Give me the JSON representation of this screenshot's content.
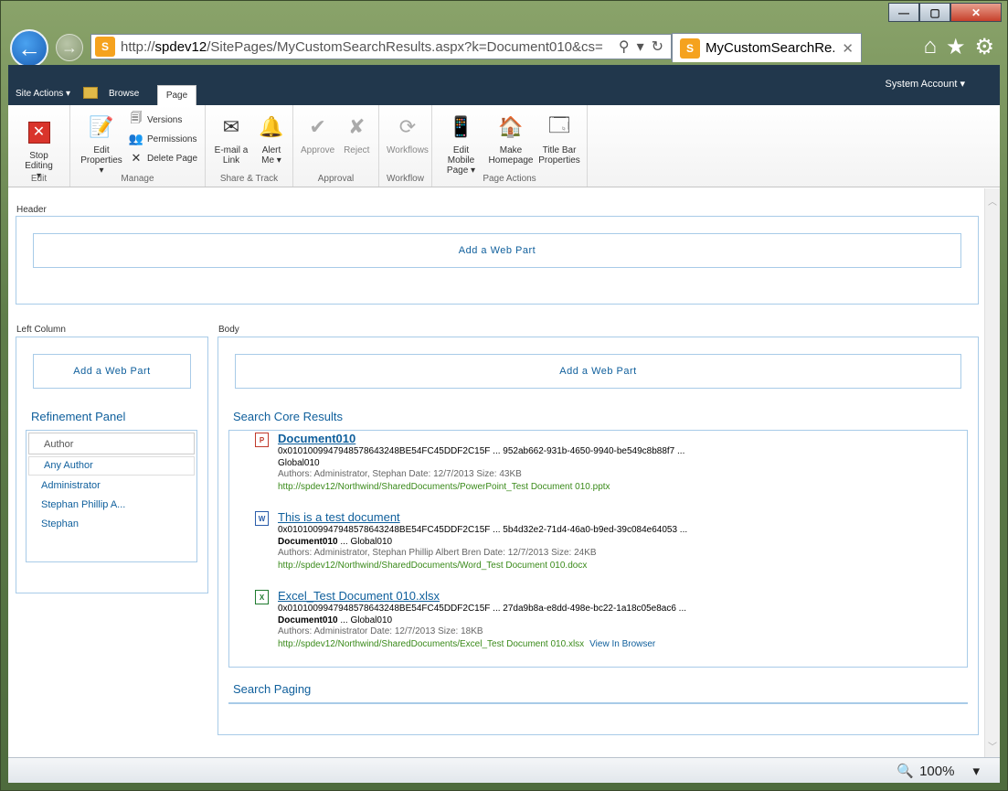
{
  "browser": {
    "url_prefix": "http://",
    "url_host": "spdev12",
    "url_rest": "/SitePages/MyCustomSearchResults.aspx?k=Document010&cs=",
    "tab_title": "MyCustomSearchRe...",
    "tab_close": "✕",
    "win_min": "—",
    "win_max": "▢",
    "win_close": "✕",
    "zoom": "100%"
  },
  "ribbon_top": {
    "site_actions": "Site Actions ▾",
    "tab_browse": "Browse",
    "tab_page": "Page",
    "system_account": "System Account ▾"
  },
  "ribbon": {
    "edit": {
      "stop_editing": "Stop Editing",
      "group": "Edit"
    },
    "manage": {
      "edit_properties": "Edit Properties ▾",
      "versions": "Versions",
      "permissions": "Permissions",
      "delete_page": "Delete Page",
      "group": "Manage"
    },
    "share": {
      "email_link": "E-mail a Link",
      "alert_me": "Alert Me ▾",
      "group": "Share & Track"
    },
    "approval": {
      "approve": "Approve",
      "reject": "Reject",
      "group": "Approval"
    },
    "workflow": {
      "workflows": "Workflows",
      "group": "Workflow"
    },
    "page_actions": {
      "edit_mobile": "Edit Mobile Page ▾",
      "make_homepage": "Make Homepage",
      "title_bar": "Title Bar Properties",
      "group": "Page Actions"
    }
  },
  "zones": {
    "header_label": "Header",
    "left_label": "Left Column",
    "body_label": "Body",
    "add_web_part": "Add a Web Part"
  },
  "refinement": {
    "title": "Refinement Panel",
    "heading": "Author",
    "items": [
      "Any Author",
      "Administrator",
      "Stephan Phillip A...",
      "Stephan"
    ]
  },
  "results": {
    "title": "Search Core Results",
    "items": [
      {
        "title": "Document010",
        "line1": "0x010100994794857864324​8BE54FC45DDF2C15F ...  952ab662-931b-4650-9940-be549c8b88f7 ...",
        "line2_bold": "",
        "line2": "Global010",
        "meta": "Authors: Administrator, Stephan   Date: 12/7/2013   Size: 43KB",
        "url": "http://spdev12/Northwind/SharedDocuments/PowerPoint_Test Document 010.pptx",
        "extra": ""
      },
      {
        "title": "This is a test document",
        "line1": "0x0101009947948578643248BE54FC45DDF2C15F ...  5b4d32e2-71d4-46a0-b9ed-39c084e64053 ...",
        "line2_bold": "Document010",
        "line2": " ... Global010",
        "meta": "Authors: Administrator, Stephan Phillip Albert Bren   Date: 12/7/2013   Size: 24KB",
        "url": "http://spdev12/Northwind/SharedDocuments/Word_Test Document 010.docx",
        "extra": ""
      },
      {
        "title": "Excel_Test Document 010.xlsx",
        "line1": "0x0101009947948578643248BE54FC45DDF2C15F ...  27da9b8a-e8dd-498e-bc22-1a18c05e8ac6 ...",
        "line2_bold": "Document010",
        "line2": " ... Global010",
        "meta": "Authors: Administrator   Date: 12/7/2013   Size: 18KB",
        "url": "http://spdev12/Northwind/SharedDocuments/Excel_Test Document 010.xlsx",
        "extra": "View In Browser"
      }
    ]
  },
  "paging": {
    "title": "Search Paging"
  }
}
